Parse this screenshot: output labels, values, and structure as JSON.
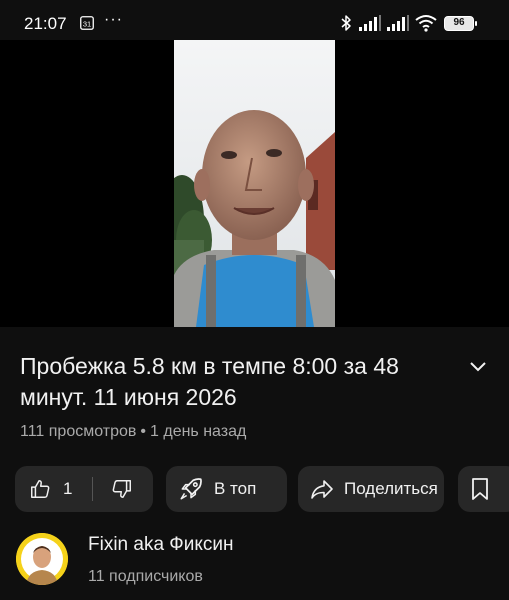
{
  "status_bar": {
    "time": "21:07",
    "calendar_day": "31",
    "more": "···",
    "battery": "96"
  },
  "video": {
    "title": "Пробежка 5.8 км в темпе 8:00 за 48 минут. 11 июня 2026",
    "views": "111 просмотров",
    "separator": "•",
    "age": "1 день назад"
  },
  "actions": {
    "like_count": "1",
    "top_label": "В топ",
    "share_label": "Поделиться"
  },
  "channel": {
    "name": "Fixin aka Фиксин",
    "subscribers": "11 подписчиков"
  },
  "colors": {
    "background": "#0f0f0f",
    "pill": "#272727",
    "secondary_text": "#aaaaaa",
    "avatar_ring": "#f5d21a"
  },
  "icons": [
    "calendar-icon",
    "bluetooth-icon",
    "signal-icon",
    "wifi-icon",
    "battery-icon",
    "chevron-down-icon",
    "thumb-up-icon",
    "thumb-down-icon",
    "rocket-icon",
    "share-icon",
    "bookmark-icon"
  ]
}
